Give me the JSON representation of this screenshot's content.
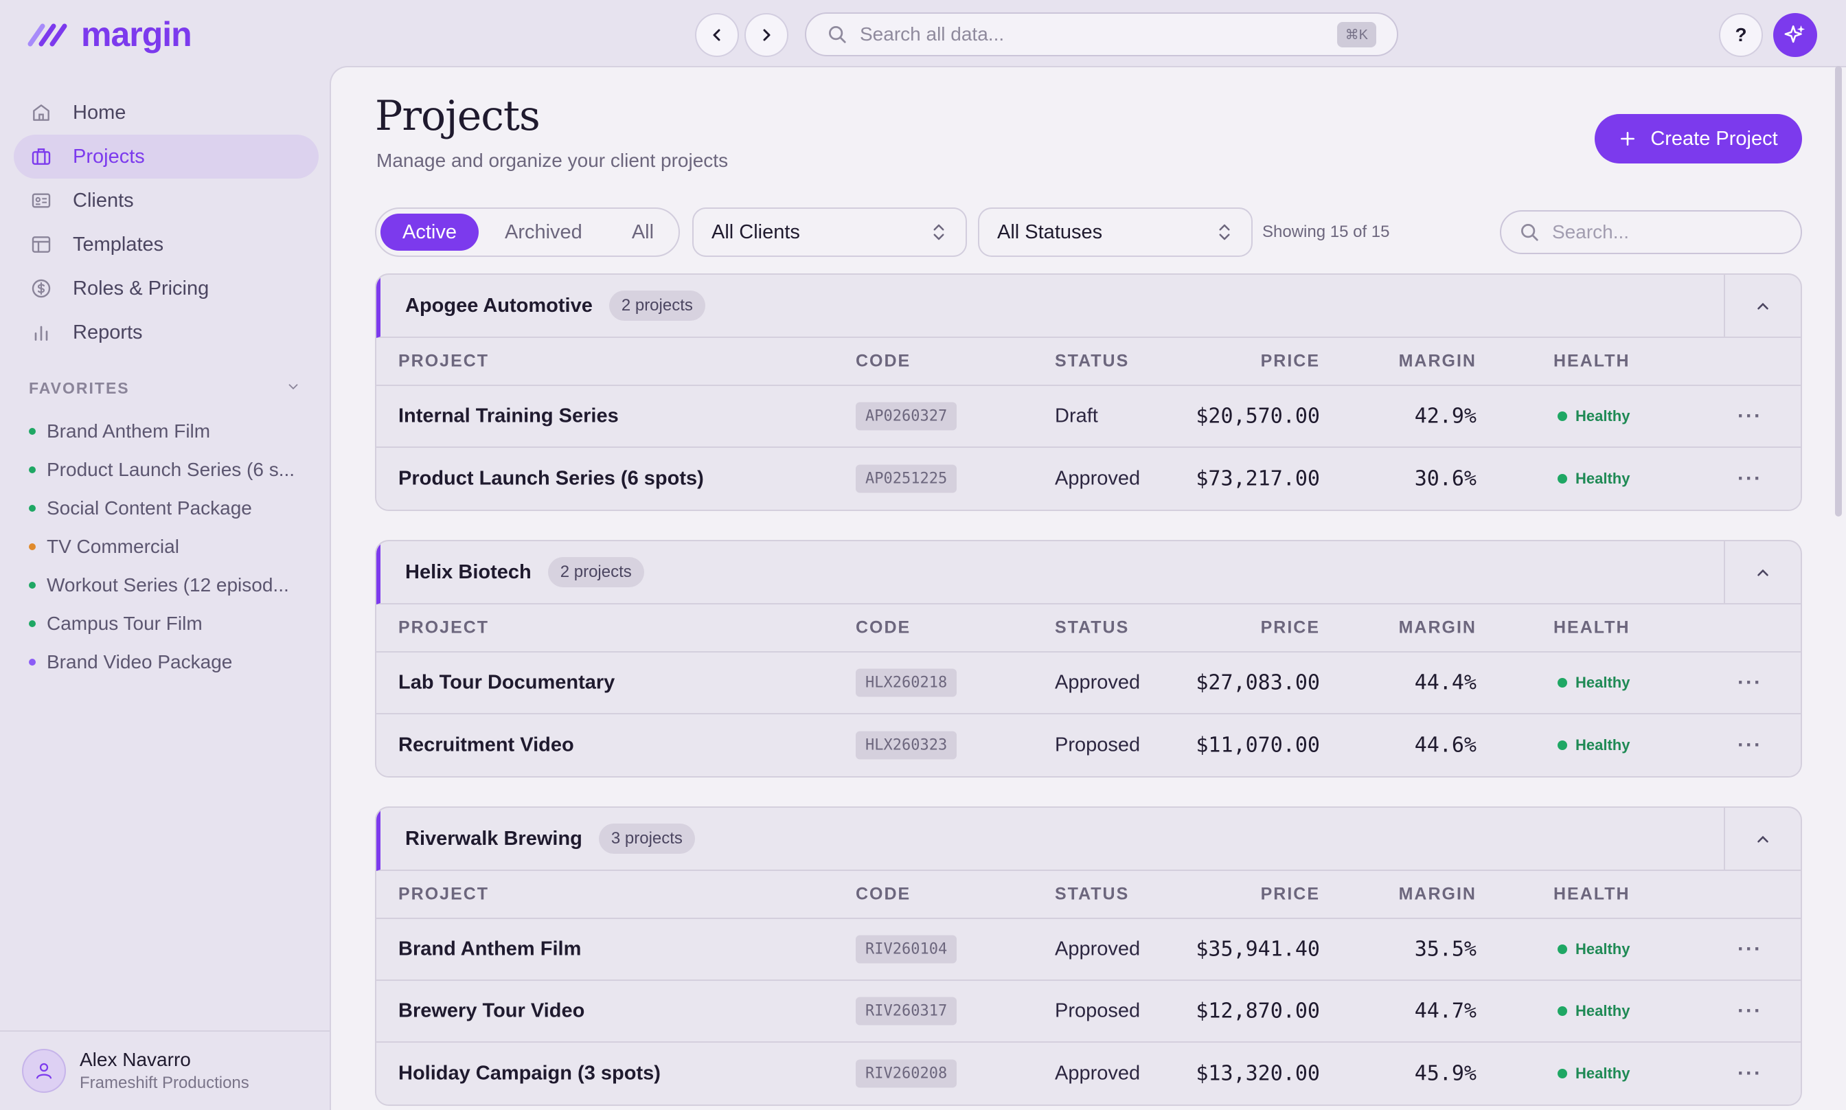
{
  "app": {
    "name": "margin",
    "search_placeholder": "Search all data...",
    "search_shortcut": "⌘K",
    "help_label": "?"
  },
  "sidebar": {
    "items": [
      {
        "label": "Home",
        "icon": "home-icon"
      },
      {
        "label": "Projects",
        "icon": "briefcase-icon",
        "active": true
      },
      {
        "label": "Clients",
        "icon": "id-card-icon"
      },
      {
        "label": "Templates",
        "icon": "layout-icon"
      },
      {
        "label": "Roles & Pricing",
        "icon": "dollar-circle-icon"
      },
      {
        "label": "Reports",
        "icon": "bar-chart-icon"
      }
    ],
    "favorites_title": "FAVORITES",
    "favorites": [
      {
        "label": "Brand Anthem Film",
        "color": "#1fa764"
      },
      {
        "label": "Product Launch Series (6 s...",
        "color": "#1fa764"
      },
      {
        "label": "Social Content Package",
        "color": "#1fa764"
      },
      {
        "label": "TV Commercial",
        "color": "#e08a2c"
      },
      {
        "label": "Workout Series (12 episod...",
        "color": "#1fa764"
      },
      {
        "label": "Campus Tour Film",
        "color": "#1fa764"
      },
      {
        "label": "Brand Video Package",
        "color": "#8b5cf6"
      }
    ],
    "user": {
      "name": "Alex Navarro",
      "org": "Frameshift Productions"
    }
  },
  "main": {
    "title": "Projects",
    "subtitle": "Manage and organize your client projects",
    "create_label": "Create Project",
    "filters": {
      "tabs": [
        "Active",
        "Archived",
        "All"
      ],
      "active_tab": "Active",
      "client_select": "All Clients",
      "status_select": "All Statuses",
      "showing": "Showing 15 of 15",
      "search_placeholder": "Search..."
    },
    "columns": [
      "PROJECT",
      "CODE",
      "STATUS",
      "PRICE",
      "MARGIN",
      "HEALTH"
    ],
    "groups": [
      {
        "name": "Apogee Automotive",
        "count": "2 projects",
        "rows": [
          {
            "project": "Internal Training Series",
            "code": "AP0260327",
            "status": "Draft",
            "price": "$20,570.00",
            "margin": "42.9%",
            "health": "Healthy"
          },
          {
            "project": "Product Launch Series (6 spots)",
            "code": "AP0251225",
            "status": "Approved",
            "price": "$73,217.00",
            "margin": "30.6%",
            "health": "Healthy"
          }
        ]
      },
      {
        "name": "Helix Biotech",
        "count": "2 projects",
        "rows": [
          {
            "project": "Lab Tour Documentary",
            "code": "HLX260218",
            "status": "Approved",
            "price": "$27,083.00",
            "margin": "44.4%",
            "health": "Healthy"
          },
          {
            "project": "Recruitment Video",
            "code": "HLX260323",
            "status": "Proposed",
            "price": "$11,070.00",
            "margin": "44.6%",
            "health": "Healthy"
          }
        ]
      },
      {
        "name": "Riverwalk Brewing",
        "count": "3 projects",
        "rows": [
          {
            "project": "Brand Anthem Film",
            "code": "RIV260104",
            "status": "Approved",
            "price": "$35,941.40",
            "margin": "35.5%",
            "health": "Healthy"
          },
          {
            "project": "Brewery Tour Video",
            "code": "RIV260317",
            "status": "Proposed",
            "price": "$12,870.00",
            "margin": "44.7%",
            "health": "Healthy"
          },
          {
            "project": "Holiday Campaign (3 spots)",
            "code": "RIV260208",
            "status": "Approved",
            "price": "$13,320.00",
            "margin": "45.9%",
            "health": "Healthy"
          }
        ]
      }
    ]
  },
  "colors": {
    "accent": "#7c3aed",
    "healthy": "#1fa764",
    "background": "#e7e3ef"
  }
}
